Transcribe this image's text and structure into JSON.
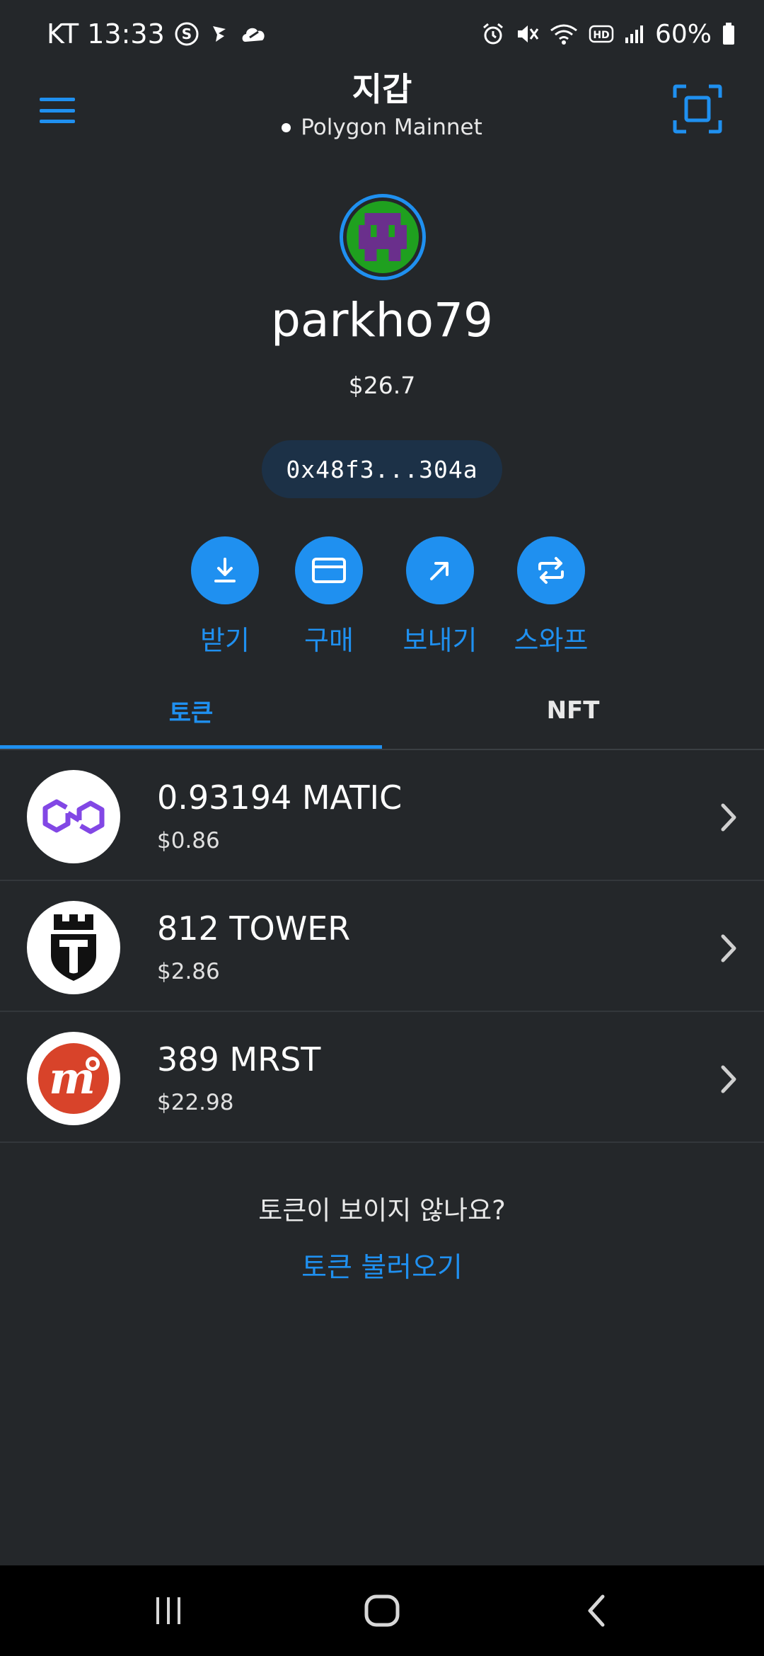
{
  "status_bar": {
    "carrier_time": "KT 13:33",
    "battery": "60%"
  },
  "header": {
    "title": "지갑",
    "network": "Polygon Mainnet"
  },
  "account": {
    "name": "parkho79",
    "balance": "$26.7",
    "address": "0x48f3...304a"
  },
  "actions": [
    {
      "label": "받기",
      "icon": "download-icon"
    },
    {
      "label": "구매",
      "icon": "card-icon"
    },
    {
      "label": "보내기",
      "icon": "arrow-up-right-icon"
    },
    {
      "label": "스와프",
      "icon": "swap-icon"
    }
  ],
  "tabs": [
    {
      "label": "토큰",
      "active": true
    },
    {
      "label": "NFT",
      "active": false
    }
  ],
  "tokens": [
    {
      "amount": "0.93194 MATIC",
      "fiat": "$0.86",
      "logo": "polygon-logo"
    },
    {
      "amount": "812 TOWER",
      "fiat": "$2.86",
      "logo": "tower-logo"
    },
    {
      "amount": "389 MRST",
      "fiat": "$22.98",
      "logo": "mrst-logo"
    }
  ],
  "empty_prompt": {
    "question": "토큰이 보이지 않나요?",
    "link": "토큰 불러오기"
  },
  "colors": {
    "background": "#24272a",
    "accent": "#1f90f0",
    "pill": "#1c3147"
  }
}
